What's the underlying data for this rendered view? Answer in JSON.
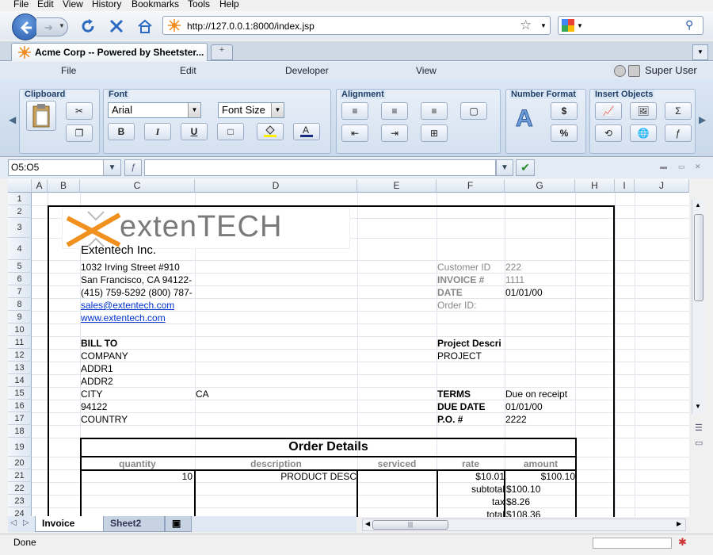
{
  "browser": {
    "menu": [
      "File",
      "Edit",
      "View",
      "History",
      "Bookmarks",
      "Tools",
      "Help"
    ],
    "url": "http://127.0.0.1:8000/index.jsp",
    "tab_title": "Acme Corp -- Powered by Sheetster..."
  },
  "app": {
    "menu": [
      "File",
      "Edit",
      "Developer",
      "View"
    ],
    "user": "Super User"
  },
  "ribbon": {
    "groups": [
      "Clipboard",
      "Font",
      "Alignment",
      "Number Format",
      "Insert Objects"
    ],
    "font_name": "Arial",
    "font_size": "Font Size",
    "bold": "B",
    "italic": "I",
    "underline": "U"
  },
  "formula": {
    "cell_ref": "O5:O5",
    "value": ""
  },
  "grid": {
    "columns": [
      "A",
      "B",
      "C",
      "D",
      "E",
      "F",
      "G",
      "H",
      "I",
      "J"
    ],
    "rows": [
      "1",
      "2",
      "3",
      "4",
      "5",
      "6",
      "7",
      "8",
      "9",
      "10",
      "11",
      "12",
      "13",
      "14",
      "15",
      "16",
      "17",
      "18",
      "19",
      "20",
      "21",
      "22",
      "23",
      "24"
    ],
    "logo_text": "extenTECH",
    "company_name": "Extentech Inc.",
    "address": "1032 Irving Street #910",
    "city_line": "San Francisco, CA 94122-",
    "phone": "(415) 759-5292 (800) 787-",
    "email": "sales@extentech.com",
    "website": "www.extentech.com",
    "bill_to": "BILL TO",
    "company": "COMPANY",
    "addr1": "ADDR1",
    "addr2": "ADDR2",
    "city": "CITY",
    "state": "CA",
    "zip": "94122",
    "country": "COUNTRY",
    "customer_id_label": "Customer ID",
    "customer_id": "222",
    "invoice_label": "INVOICE #",
    "invoice": "1111",
    "date_label": "DATE",
    "date": "01/01/00",
    "order_id_label": "Order ID:",
    "project_desc_label": "Project Descri",
    "project": "PROJECT",
    "terms_label": "TERMS",
    "terms": "Due on receipt",
    "due_date_label": "DUE DATE",
    "due_date": "01/01/00",
    "po_label": "P.O. #",
    "po": "2222",
    "order_title": "Order Details",
    "order_headers": [
      "quantity",
      "description",
      "serviced",
      "rate",
      "amount"
    ],
    "quantity": "10",
    "description": "PRODUCT DESC",
    "rate": "$10.01",
    "amount": "$100.10",
    "subtotal_label": "subtotal",
    "subtotal": "$100.10",
    "tax_label": "tax",
    "tax": "$8.26",
    "total_label": "total",
    "total": "$108.36"
  },
  "sheets": [
    "Invoice",
    "Sheet2"
  ],
  "status": "Done"
}
